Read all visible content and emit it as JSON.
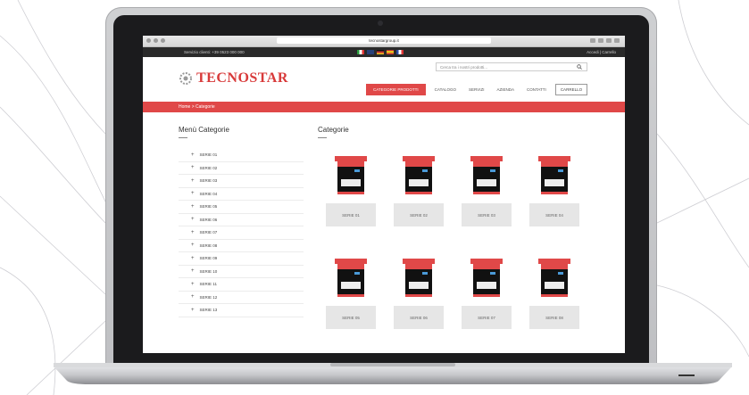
{
  "browser": {
    "url": "tecnostargroup.it"
  },
  "topbar": {
    "contact": "Servizio clienti: +39 0523 000 000",
    "account": "Accedi | Carrello"
  },
  "header": {
    "logo_text": "TECNOSTAR",
    "search_placeholder": "Cerca tra i nostri prodotti...",
    "nav": [
      {
        "label": "CATEGORIE PRODOTTI",
        "active": true
      },
      {
        "label": "CATALOGO",
        "active": false
      },
      {
        "label": "SERVIZI",
        "active": false
      },
      {
        "label": "AZIENDA",
        "active": false
      },
      {
        "label": "CONTATTI",
        "active": false
      }
    ],
    "nav_button": "CARRELLO"
  },
  "breadcrumb": "Home > Categorie",
  "sidebar": {
    "title": "Menù Categorie",
    "items": [
      "SERIE 01",
      "SERIE 02",
      "SERIE 03",
      "SERIE 04",
      "SERIE 05",
      "SERIE 06",
      "SERIE 07",
      "SERIE 08",
      "SERIE 09",
      "SERIE 10",
      "SERIE 11",
      "SERIE 12",
      "SERIE 13"
    ]
  },
  "grid": {
    "title": "Categorie",
    "products": [
      "SERIE 01",
      "SERIE 02",
      "SERIE 03",
      "SERIE 04",
      "SERIE 05",
      "SERIE 06",
      "SERIE 07",
      "SERIE 08"
    ]
  },
  "colors": {
    "accent": "#e04848",
    "dark": "#2a2a2a"
  }
}
